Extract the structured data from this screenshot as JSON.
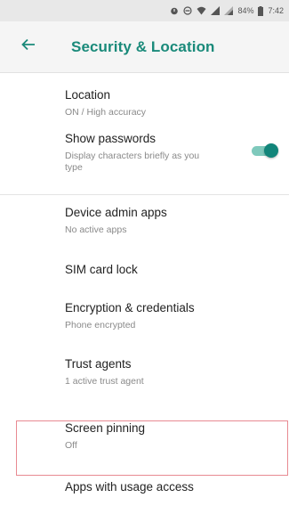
{
  "status_bar": {
    "battery": "84%",
    "time": "7:42",
    "icons": [
      "alarm-icon",
      "dnd-icon",
      "wifi-icon",
      "signal-icon",
      "signal-icon",
      "battery-icon"
    ]
  },
  "app_bar": {
    "title": "Security & Location",
    "back_icon": "arrow-back-icon",
    "accent": "#1a8a7a"
  },
  "items": [
    {
      "title": "Location",
      "summary": "ON / High accuracy"
    },
    {
      "title": "Show passwords",
      "summary": "Display characters briefly as you type",
      "toggle": true,
      "toggle_on": true
    },
    {
      "title": "Device admin apps",
      "summary": "No active apps"
    },
    {
      "title": "SIM card lock",
      "summary": ""
    },
    {
      "title": "Encryption & credentials",
      "summary": "Phone encrypted"
    },
    {
      "title": "Trust agents",
      "summary": "1 active trust agent"
    },
    {
      "title": "Screen pinning",
      "summary": "Off"
    },
    {
      "title": "Apps with usage access",
      "summary": ""
    }
  ],
  "highlight_color": "#e88a92"
}
